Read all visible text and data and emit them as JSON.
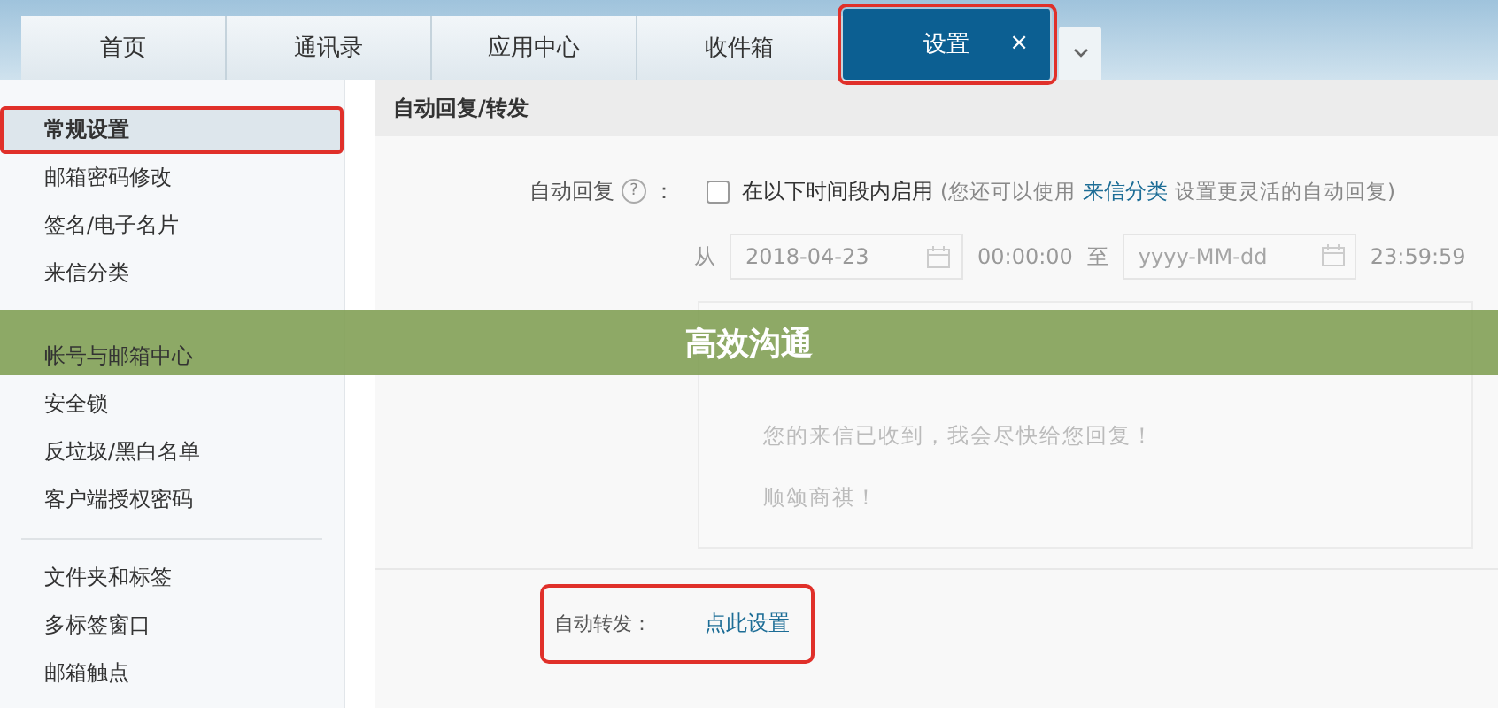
{
  "tabs": [
    {
      "label": "首页",
      "selected": false,
      "highlighted": false
    },
    {
      "label": "通讯录",
      "selected": false,
      "highlighted": false
    },
    {
      "label": "应用中心",
      "selected": false,
      "highlighted": false
    },
    {
      "label": "收件箱",
      "selected": false,
      "highlighted": false
    },
    {
      "label": "设置",
      "selected": true,
      "highlighted": true,
      "close": "×"
    }
  ],
  "sidebar": {
    "groups": [
      {
        "items": [
          {
            "label": "常规设置",
            "selected": true,
            "highlighted": true
          },
          {
            "label": "邮箱密码修改",
            "selected": false,
            "highlighted": false
          },
          {
            "label": "签名/电子名片",
            "selected": false,
            "highlighted": false
          },
          {
            "label": "来信分类",
            "selected": false,
            "highlighted": false
          }
        ]
      },
      {
        "items": [
          {
            "label": "帐号与邮箱中心",
            "selected": false,
            "highlighted": false
          },
          {
            "label": "安全锁",
            "selected": false,
            "highlighted": false
          },
          {
            "label": "反垃圾/黑白名单",
            "selected": false,
            "highlighted": false
          },
          {
            "label": "客户端授权密码",
            "selected": false,
            "highlighted": false
          }
        ]
      },
      {
        "items": [
          {
            "label": "文件夹和标签",
            "selected": false,
            "highlighted": false
          },
          {
            "label": "多标签窗口",
            "selected": false,
            "highlighted": false
          },
          {
            "label": "邮箱触点",
            "selected": false,
            "highlighted": false
          }
        ]
      }
    ]
  },
  "section": {
    "title": "自动回复/转发",
    "auto_reply": {
      "label": "自动回复",
      "help": "?",
      "colon": "：",
      "checked": false,
      "checkbox_label": "在以下时间段内启用",
      "hint_before": "(您还可以使用",
      "hint_link": "来信分类",
      "hint_after": "设置更灵活的自动回复)",
      "from_label": "从",
      "start_date": "2018-04-23",
      "start_time": "00:00:00",
      "to_label": "至",
      "end_date_placeholder": "yyyy-MM-dd",
      "end_time": "23:59:59",
      "message_lines": [
        "您的来信已收到，我会尽快给您回复！",
        "顺颂商祺！"
      ]
    },
    "auto_forward": {
      "label": "自动转发：",
      "link": "点此设置",
      "highlighted": true
    }
  },
  "banner": {
    "title": "高效沟通"
  }
}
